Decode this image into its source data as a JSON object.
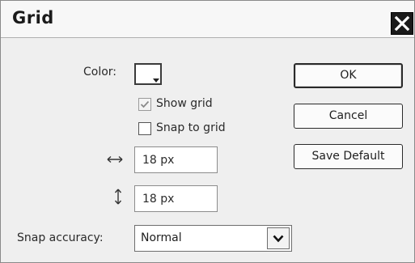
{
  "dialog": {
    "title": "Grid"
  },
  "fields": {
    "color_label": "Color:",
    "show_grid_label": "Show grid",
    "show_grid_checked": true,
    "snap_to_grid_label": "Snap to grid",
    "snap_to_grid_checked": false,
    "horizontal_spacing": "18 px",
    "vertical_spacing": "18 px",
    "snap_accuracy_label": "Snap accuracy:",
    "snap_accuracy_value": "Normal"
  },
  "buttons": {
    "ok": "OK",
    "cancel": "Cancel",
    "save_default": "Save Default"
  },
  "icons": {
    "close": "close-icon",
    "horizontal": "horizontal-arrows-icon",
    "vertical": "vertical-arrows-icon",
    "dropdown": "chevron-down-icon"
  },
  "colors": {
    "grid_color": "#ffffff"
  }
}
